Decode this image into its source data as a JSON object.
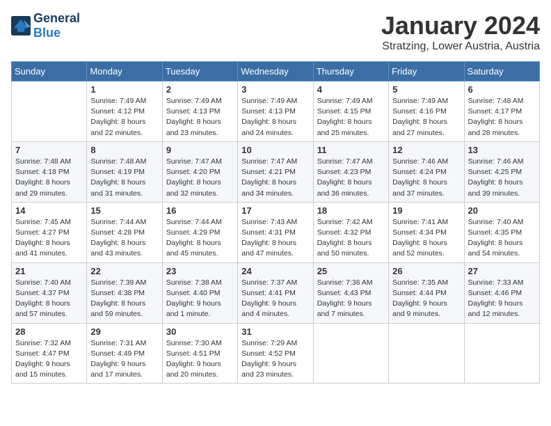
{
  "logo": {
    "general": "General",
    "blue": "Blue"
  },
  "title": "January 2024",
  "location": "Stratzing, Lower Austria, Austria",
  "days_of_week": [
    "Sunday",
    "Monday",
    "Tuesday",
    "Wednesday",
    "Thursday",
    "Friday",
    "Saturday"
  ],
  "weeks": [
    [
      {
        "day": "",
        "info": ""
      },
      {
        "day": "1",
        "info": "Sunrise: 7:49 AM\nSunset: 4:12 PM\nDaylight: 8 hours\nand 22 minutes."
      },
      {
        "day": "2",
        "info": "Sunrise: 7:49 AM\nSunset: 4:13 PM\nDaylight: 8 hours\nand 23 minutes."
      },
      {
        "day": "3",
        "info": "Sunrise: 7:49 AM\nSunset: 4:13 PM\nDaylight: 8 hours\nand 24 minutes."
      },
      {
        "day": "4",
        "info": "Sunrise: 7:49 AM\nSunset: 4:15 PM\nDaylight: 8 hours\nand 25 minutes."
      },
      {
        "day": "5",
        "info": "Sunrise: 7:49 AM\nSunset: 4:16 PM\nDaylight: 8 hours\nand 27 minutes."
      },
      {
        "day": "6",
        "info": "Sunrise: 7:48 AM\nSunset: 4:17 PM\nDaylight: 8 hours\nand 28 minutes."
      }
    ],
    [
      {
        "day": "7",
        "info": "Sunrise: 7:48 AM\nSunset: 4:18 PM\nDaylight: 8 hours\nand 29 minutes."
      },
      {
        "day": "8",
        "info": "Sunrise: 7:48 AM\nSunset: 4:19 PM\nDaylight: 8 hours\nand 31 minutes."
      },
      {
        "day": "9",
        "info": "Sunrise: 7:47 AM\nSunset: 4:20 PM\nDaylight: 8 hours\nand 32 minutes."
      },
      {
        "day": "10",
        "info": "Sunrise: 7:47 AM\nSunset: 4:21 PM\nDaylight: 8 hours\nand 34 minutes."
      },
      {
        "day": "11",
        "info": "Sunrise: 7:47 AM\nSunset: 4:23 PM\nDaylight: 8 hours\nand 36 minutes."
      },
      {
        "day": "12",
        "info": "Sunrise: 7:46 AM\nSunset: 4:24 PM\nDaylight: 8 hours\nand 37 minutes."
      },
      {
        "day": "13",
        "info": "Sunrise: 7:46 AM\nSunset: 4:25 PM\nDaylight: 8 hours\nand 39 minutes."
      }
    ],
    [
      {
        "day": "14",
        "info": "Sunrise: 7:45 AM\nSunset: 4:27 PM\nDaylight: 8 hours\nand 41 minutes."
      },
      {
        "day": "15",
        "info": "Sunrise: 7:44 AM\nSunset: 4:28 PM\nDaylight: 8 hours\nand 43 minutes."
      },
      {
        "day": "16",
        "info": "Sunrise: 7:44 AM\nSunset: 4:29 PM\nDaylight: 8 hours\nand 45 minutes."
      },
      {
        "day": "17",
        "info": "Sunrise: 7:43 AM\nSunset: 4:31 PM\nDaylight: 8 hours\nand 47 minutes."
      },
      {
        "day": "18",
        "info": "Sunrise: 7:42 AM\nSunset: 4:32 PM\nDaylight: 8 hours\nand 50 minutes."
      },
      {
        "day": "19",
        "info": "Sunrise: 7:41 AM\nSunset: 4:34 PM\nDaylight: 8 hours\nand 52 minutes."
      },
      {
        "day": "20",
        "info": "Sunrise: 7:40 AM\nSunset: 4:35 PM\nDaylight: 8 hours\nand 54 minutes."
      }
    ],
    [
      {
        "day": "21",
        "info": "Sunrise: 7:40 AM\nSunset: 4:37 PM\nDaylight: 8 hours\nand 57 minutes."
      },
      {
        "day": "22",
        "info": "Sunrise: 7:39 AM\nSunset: 4:38 PM\nDaylight: 8 hours\nand 59 minutes."
      },
      {
        "day": "23",
        "info": "Sunrise: 7:38 AM\nSunset: 4:40 PM\nDaylight: 9 hours\nand 1 minute."
      },
      {
        "day": "24",
        "info": "Sunrise: 7:37 AM\nSunset: 4:41 PM\nDaylight: 9 hours\nand 4 minutes."
      },
      {
        "day": "25",
        "info": "Sunrise: 7:36 AM\nSunset: 4:43 PM\nDaylight: 9 hours\nand 7 minutes."
      },
      {
        "day": "26",
        "info": "Sunrise: 7:35 AM\nSunset: 4:44 PM\nDaylight: 9 hours\nand 9 minutes."
      },
      {
        "day": "27",
        "info": "Sunrise: 7:33 AM\nSunset: 4:46 PM\nDaylight: 9 hours\nand 12 minutes."
      }
    ],
    [
      {
        "day": "28",
        "info": "Sunrise: 7:32 AM\nSunset: 4:47 PM\nDaylight: 9 hours\nand 15 minutes."
      },
      {
        "day": "29",
        "info": "Sunrise: 7:31 AM\nSunset: 4:49 PM\nDaylight: 9 hours\nand 17 minutes."
      },
      {
        "day": "30",
        "info": "Sunrise: 7:30 AM\nSunset: 4:51 PM\nDaylight: 9 hours\nand 20 minutes."
      },
      {
        "day": "31",
        "info": "Sunrise: 7:29 AM\nSunset: 4:52 PM\nDaylight: 9 hours\nand 23 minutes."
      },
      {
        "day": "",
        "info": ""
      },
      {
        "day": "",
        "info": ""
      },
      {
        "day": "",
        "info": ""
      }
    ]
  ]
}
